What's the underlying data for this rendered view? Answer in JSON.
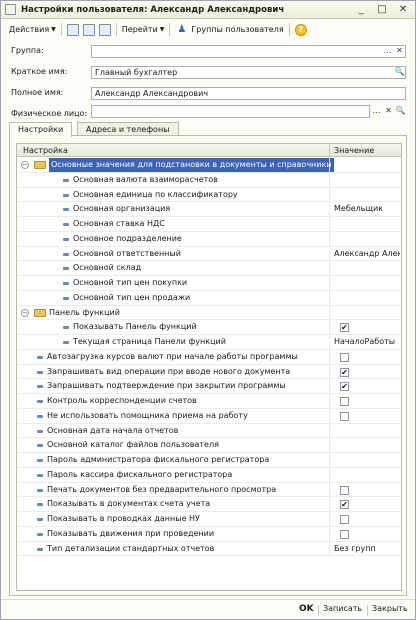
{
  "window": {
    "title": "Настройки пользователя: Александр Александрович",
    "controls": [
      "_",
      "□",
      "✕"
    ]
  },
  "toolbar": {
    "actions_label": "Действия",
    "goto_label": "Перейти",
    "user_groups_label": "Группы пользователя",
    "help_label": "?"
  },
  "fields": {
    "group": {
      "label": "Группа:",
      "value": ""
    },
    "short_name": {
      "label": "Краткое имя:",
      "value": "Главный бухгалтер"
    },
    "full_name": {
      "label": "Полное имя:",
      "value": "Александр Александрович"
    },
    "physical_person": {
      "label": "Физическое лицо:",
      "value": ""
    }
  },
  "tabs": [
    {
      "label": "Настройки",
      "active": true
    },
    {
      "label": "Адреса и телефоны",
      "active": false
    }
  ],
  "grid": {
    "columns": [
      "Настройка",
      "Значение"
    ],
    "rows": [
      {
        "label": "Основные значения для подстановки в документы и справочники",
        "value": "",
        "kind": "group",
        "level": 0,
        "selected": true
      },
      {
        "label": "Основная валюта взаиморасчетов",
        "value": "",
        "kind": "leaf",
        "level": 1
      },
      {
        "label": "Основная единица по классификатору",
        "value": "",
        "kind": "leaf",
        "level": 1
      },
      {
        "label": "Основная организация",
        "value": "Мебельщик",
        "kind": "leaf",
        "level": 1
      },
      {
        "label": "Основная ставка НДС",
        "value": "",
        "kind": "leaf",
        "level": 1
      },
      {
        "label": "Основное подразделение",
        "value": "",
        "kind": "leaf",
        "level": 1
      },
      {
        "label": "Основной ответственный",
        "value": "Александр Алек...",
        "kind": "leaf",
        "level": 1
      },
      {
        "label": "Основной склад",
        "value": "",
        "kind": "leaf",
        "level": 1
      },
      {
        "label": "Основной тип цен покупки",
        "value": "",
        "kind": "leaf",
        "level": 1
      },
      {
        "label": "Основной тип цен продажи",
        "value": "",
        "kind": "leaf",
        "level": 1
      },
      {
        "label": "Панель функций",
        "value": "",
        "kind": "group",
        "level": 0
      },
      {
        "label": "Показывать Панель функций",
        "value": "",
        "kind": "leaf",
        "level": 1,
        "checkbox": true,
        "checked": true
      },
      {
        "label": "Текущая страница Панели функций",
        "value": "НачалоРаботы",
        "kind": "leaf",
        "level": 1
      },
      {
        "label": "Автозагрузка курсов валют при начале работы программы",
        "value": "",
        "kind": "leaf",
        "level": 0,
        "checkbox": true,
        "checked": false
      },
      {
        "label": "Запрашивать вид операции при вводе нового документа",
        "value": "",
        "kind": "leaf",
        "level": 0,
        "checkbox": true,
        "checked": true
      },
      {
        "label": "Запрашивать подтверждение при закрытии программы",
        "value": "",
        "kind": "leaf",
        "level": 0,
        "checkbox": true,
        "checked": true
      },
      {
        "label": "Контроль корреспонденции счетов",
        "value": "",
        "kind": "leaf",
        "level": 0,
        "checkbox": true,
        "checked": false
      },
      {
        "label": "Не использовать помощника приема на работу",
        "value": "",
        "kind": "leaf",
        "level": 0,
        "checkbox": true,
        "checked": false
      },
      {
        "label": "Основная дата начала отчетов",
        "value": "",
        "kind": "leaf",
        "level": 0
      },
      {
        "label": "Основной каталог файлов пользователя",
        "value": "",
        "kind": "leaf",
        "level": 0
      },
      {
        "label": "Пароль администратора фискального регистратора",
        "value": "",
        "kind": "leaf",
        "level": 0
      },
      {
        "label": "Пароль кассира фискального регистратора",
        "value": "",
        "kind": "leaf",
        "level": 0
      },
      {
        "label": "Печать документов без предварительного просмотра",
        "value": "",
        "kind": "leaf",
        "level": 0,
        "checkbox": true,
        "checked": false
      },
      {
        "label": "Показывать в документах счета учета",
        "value": "",
        "kind": "leaf",
        "level": 0,
        "checkbox": true,
        "checked": true
      },
      {
        "label": "Показывать в проводках данные НУ",
        "value": "",
        "kind": "leaf",
        "level": 0,
        "checkbox": true,
        "checked": false
      },
      {
        "label": "Показывать движения при проведении",
        "value": "",
        "kind": "leaf",
        "level": 0,
        "checkbox": true,
        "checked": false
      },
      {
        "label": "Тип детализации стандартных отчетов",
        "value": "Без групп",
        "kind": "leaf",
        "level": 0
      }
    ]
  },
  "footer": {
    "ok_label": "OK",
    "save_label": "Записать",
    "close_label": "Закрыть"
  },
  "colors": {
    "selection": "#3a63b8",
    "folder": "#e9c45a",
    "leaf_marker": "#6d89b0"
  }
}
